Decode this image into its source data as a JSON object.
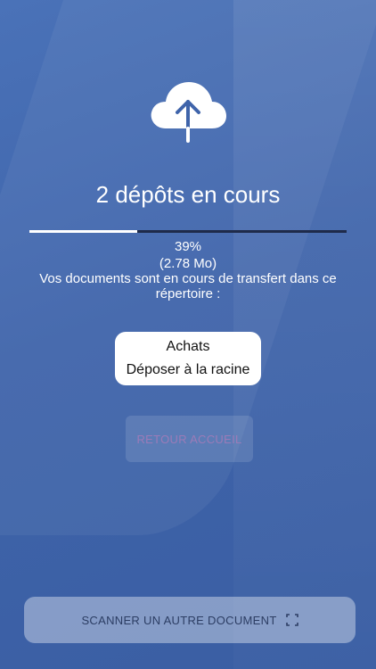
{
  "header": {
    "title": "2 dépôts en cours"
  },
  "progress": {
    "percent_label": "39%",
    "value": 0.34,
    "size_label": "(2.78 Mo)",
    "description": "Vos documents sont en cours de transfert dans ce répertoire :"
  },
  "destination": {
    "folder": "Achats",
    "option": "Déposer à la racine"
  },
  "buttons": {
    "back_label": "RETOUR ACCUEIL",
    "scan_label": "SCANNER UN AUTRE DOCUMENT"
  },
  "icons": {
    "upload": "cloud-upload-icon",
    "scan": "scan-frame-icon"
  },
  "colors": {
    "accent": "#ffffff",
    "back_text": "#9b7bb8",
    "scan_text": "#2d3e64"
  }
}
